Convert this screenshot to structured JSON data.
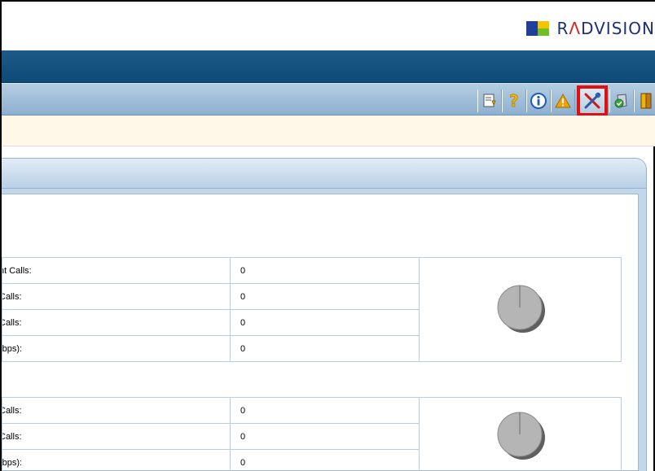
{
  "brand": {
    "name_pre": "R",
    "name_accent": "Λ",
    "name_post": "DVISION"
  },
  "toolbar": {
    "icons": [
      "report-icon",
      "help-icon",
      "info-icon",
      "warning-icon",
      "tools-icon",
      "shield-check-icon",
      "exit-door-icon"
    ],
    "selected": "tools-icon"
  },
  "group1": {
    "rows": [
      {
        "label": "nt Calls:",
        "value": "0"
      },
      {
        "label": "Calls:",
        "value": "0"
      },
      {
        "label": "Calls:",
        "value": "0"
      },
      {
        "label": "(bps):",
        "value": "0"
      }
    ]
  },
  "group2": {
    "rows": [
      {
        "label": "Calls:",
        "value": "0"
      },
      {
        "label": "Calls:",
        "value": "0"
      },
      {
        "label": "(bps):",
        "value": "0"
      }
    ]
  },
  "colors": {
    "nav": "#0e4a78",
    "toolbar": "#8db0cf",
    "highlight": "#e01010",
    "pie": "#b5b5b5"
  }
}
